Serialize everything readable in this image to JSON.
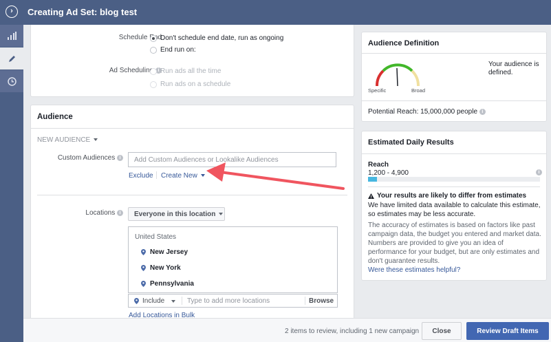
{
  "header": {
    "title": "Creating Ad Set: blog test",
    "toggle_icon": "chevron-right-circle-icon"
  },
  "sidenav": {
    "items": [
      {
        "icon": "bar-chart-icon"
      },
      {
        "icon": "pencil-icon",
        "active": true
      },
      {
        "icon": "clock-icon"
      }
    ]
  },
  "schedule": {
    "end_label": "Schedule End",
    "end_options": [
      "Don't schedule end date, run as ongoing",
      "End run on:"
    ],
    "ad_scheduling_label": "Ad Scheduling",
    "ad_scheduling_options": [
      "Run ads all the time",
      "Run ads on a schedule"
    ]
  },
  "audience": {
    "title": "Audience",
    "new_audience_label": "NEW AUDIENCE",
    "custom_audiences_label": "Custom Audiences",
    "custom_audiences_placeholder": "Add Custom Audiences or Lookalike Audiences",
    "exclude_label": "Exclude",
    "create_new_label": "Create New",
    "locations_label": "Locations",
    "locations_dropdown": "Everyone in this location",
    "country": "United States",
    "locations": [
      "New Jersey",
      "New York",
      "Pennsylvania"
    ],
    "include_label": "Include",
    "location_placeholder": "Type to add more locations",
    "browse_label": "Browse",
    "bulk_link": "Add Locations in Bulk"
  },
  "audience_definition": {
    "title": "Audience Definition",
    "gauge_left": "Specific",
    "gauge_right": "Broad",
    "status": "Your audience is defined.",
    "potential_reach": "Potential Reach: 15,000,000 people",
    "gauge_position": 0.48
  },
  "estimated_results": {
    "title": "Estimated Daily Results",
    "reach_label": "Reach",
    "reach_range": "1,200 - 4,900",
    "reach_fill_fraction": 0.05,
    "warning_title": "Your results are likely to differ from estimates",
    "warning_body": "We have limited data available to calculate this estimate, so estimates may be less accurate.",
    "accuracy_note": "The accuracy of estimates is based on factors like past campaign data, the budget you entered and market data. Numbers are provided to give you an idea of performance for your budget, but are only estimates and don't guarantee results.",
    "helpful_link": "Were these estimates helpful?"
  },
  "footer": {
    "review_note": "2 items to review, including 1 new campaign",
    "close_label": "Close",
    "review_label": "Review Draft Items"
  },
  "colors": {
    "header": "#4b5f85",
    "primary_button": "#4267b2",
    "link": "#365899",
    "arrow": "#f0555f",
    "reach_fill": "#48b7e0"
  }
}
